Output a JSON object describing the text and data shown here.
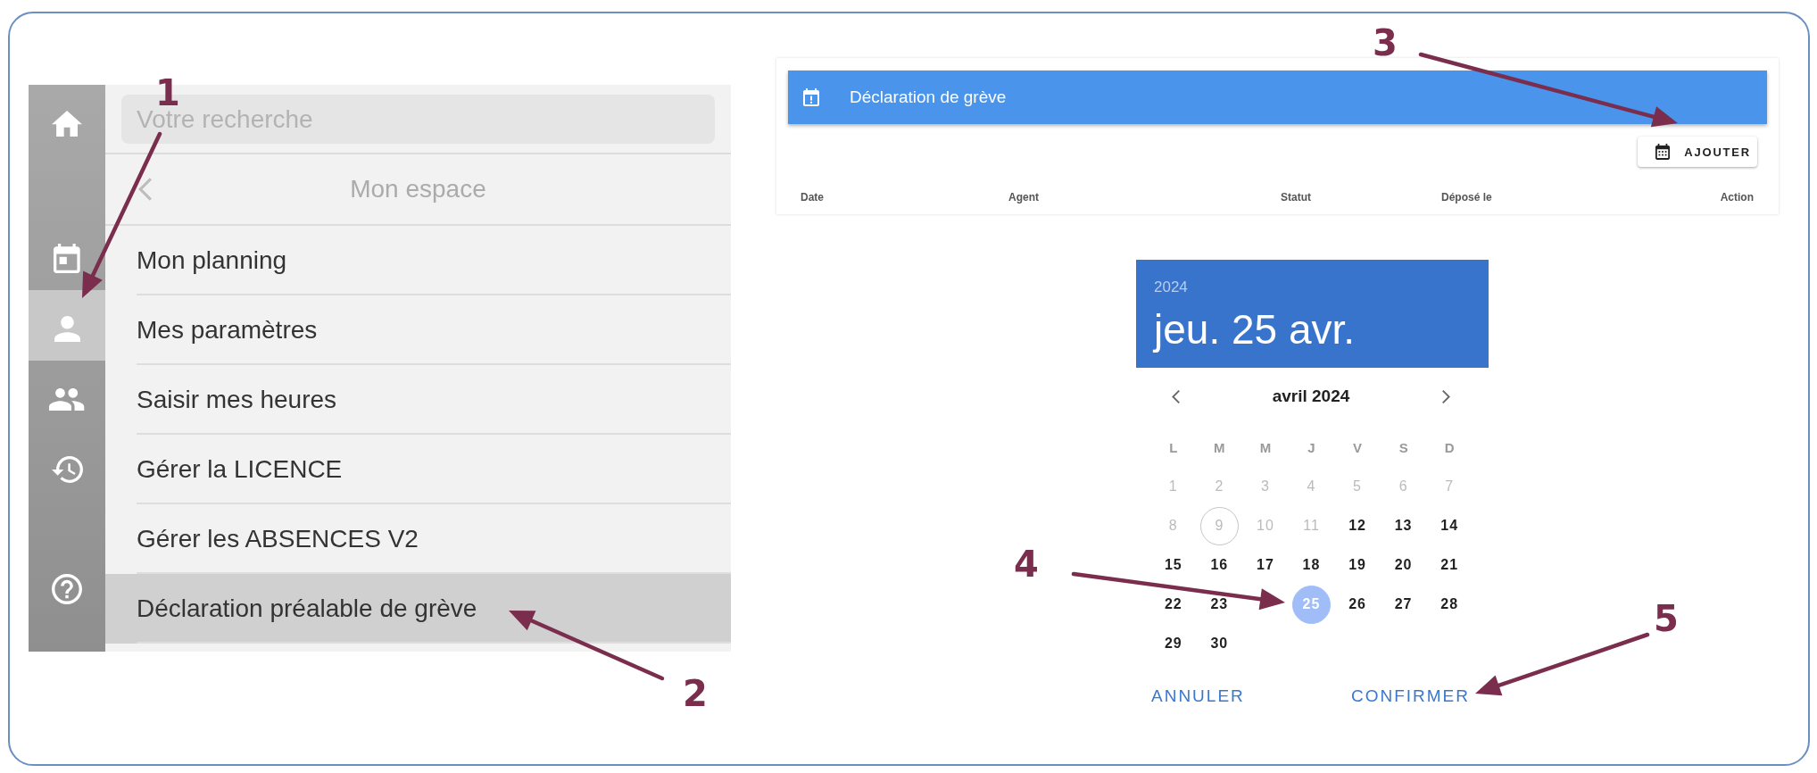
{
  "sidebar": {
    "rail": [
      {
        "kind": "home",
        "selected": false
      },
      {
        "kind": "calendar",
        "selected": false
      },
      {
        "kind": "person",
        "selected": true
      },
      {
        "kind": "group",
        "selected": false
      },
      {
        "kind": "history",
        "selected": false
      },
      {
        "kind": "help",
        "selected": false
      }
    ],
    "search": {
      "placeholder": "Votre recherche"
    },
    "header": "Mon espace",
    "items": [
      {
        "label": "Mon planning",
        "selected": false
      },
      {
        "label": "Mes paramètres",
        "selected": false
      },
      {
        "label": "Saisir mes heures",
        "selected": false
      },
      {
        "label": "Gérer la LICENCE",
        "selected": false
      },
      {
        "label": "Gérer les ABSENCES V2",
        "selected": false
      },
      {
        "label": "Déclaration préalable de grève",
        "selected": true
      }
    ]
  },
  "panel": {
    "title": "Déclaration de grève",
    "add_button": "AJOUTER",
    "columns": [
      "Date",
      "Agent",
      "Statut",
      "Déposé le",
      "Action"
    ]
  },
  "date_picker": {
    "year": "2024",
    "date": "jeu. 25 avr.",
    "month": "avril 2024",
    "weekdays": [
      "L",
      "M",
      "M",
      "J",
      "V",
      "S",
      "D"
    ],
    "days": [
      {
        "kind": "day",
        "label": "1",
        "disabled": true,
        "today": false,
        "selected": false
      },
      {
        "kind": "day",
        "label": "2",
        "disabled": true,
        "today": false,
        "selected": false
      },
      {
        "kind": "day",
        "label": "3",
        "disabled": true,
        "today": false,
        "selected": false
      },
      {
        "kind": "day",
        "label": "4",
        "disabled": true,
        "today": false,
        "selected": false
      },
      {
        "kind": "day",
        "label": "5",
        "disabled": true,
        "today": false,
        "selected": false
      },
      {
        "kind": "day",
        "label": "6",
        "disabled": true,
        "today": false,
        "selected": false
      },
      {
        "kind": "day",
        "label": "7",
        "disabled": true,
        "today": false,
        "selected": false
      },
      {
        "kind": "day",
        "label": "8",
        "disabled": true,
        "today": false,
        "selected": false
      },
      {
        "kind": "day",
        "label": "9",
        "disabled": true,
        "today": true,
        "selected": false
      },
      {
        "kind": "day",
        "label": "10",
        "disabled": true,
        "today": false,
        "selected": false
      },
      {
        "kind": "day",
        "label": "11",
        "disabled": true,
        "today": false,
        "selected": false
      },
      {
        "kind": "day",
        "label": "12",
        "disabled": false,
        "today": false,
        "selected": false
      },
      {
        "kind": "day",
        "label": "13",
        "disabled": false,
        "today": false,
        "selected": false
      },
      {
        "kind": "day",
        "label": "14",
        "disabled": false,
        "today": false,
        "selected": false
      },
      {
        "kind": "day",
        "label": "15",
        "disabled": false,
        "today": false,
        "selected": false
      },
      {
        "kind": "day",
        "label": "16",
        "disabled": false,
        "today": false,
        "selected": false
      },
      {
        "kind": "day",
        "label": "17",
        "disabled": false,
        "today": false,
        "selected": false
      },
      {
        "kind": "day",
        "label": "18",
        "disabled": false,
        "today": false,
        "selected": false
      },
      {
        "kind": "day",
        "label": "19",
        "disabled": false,
        "today": false,
        "selected": false
      },
      {
        "kind": "day",
        "label": "20",
        "disabled": false,
        "today": false,
        "selected": false
      },
      {
        "kind": "day",
        "label": "21",
        "disabled": false,
        "today": false,
        "selected": false
      },
      {
        "kind": "day",
        "label": "22",
        "disabled": false,
        "today": false,
        "selected": false
      },
      {
        "kind": "day",
        "label": "23",
        "disabled": false,
        "today": false,
        "selected": false
      },
      {
        "kind": "covered"
      },
      {
        "kind": "day",
        "label": "25",
        "disabled": false,
        "today": false,
        "selected": true
      },
      {
        "kind": "day",
        "label": "26",
        "disabled": false,
        "today": false,
        "selected": false
      },
      {
        "kind": "day",
        "label": "27",
        "disabled": false,
        "today": false,
        "selected": false
      },
      {
        "kind": "day",
        "label": "28",
        "disabled": false,
        "today": false,
        "selected": false
      },
      {
        "kind": "day",
        "label": "29",
        "disabled": false,
        "today": false,
        "selected": false
      },
      {
        "kind": "day",
        "label": "30",
        "disabled": false,
        "today": false,
        "selected": false
      }
    ],
    "actions": [
      "ANNULER",
      "CONFIRMER"
    ]
  },
  "annotations": [
    "1",
    "2",
    "3",
    "4",
    "5"
  ]
}
